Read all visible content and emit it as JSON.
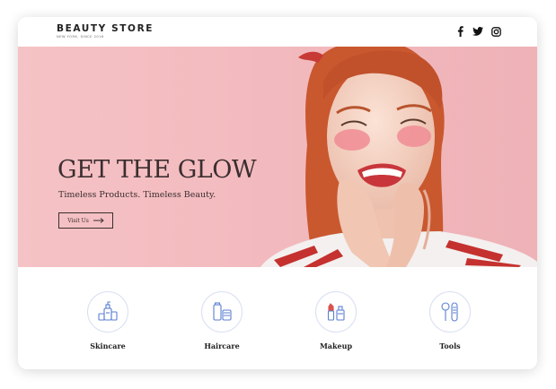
{
  "header": {
    "brand": "BEAUTY STORE",
    "tagline": "NEW YORK, SINCE 2016",
    "socials": [
      {
        "icon": "facebook-icon"
      },
      {
        "icon": "twitter-icon"
      },
      {
        "icon": "instagram-icon"
      }
    ]
  },
  "hero": {
    "title": "GET THE GLOW",
    "subtitle": "Timeless Products. Timeless Beauty.",
    "cta_label": "Visit Us",
    "cta_icon": "arrow-right-icon"
  },
  "categories": [
    {
      "label": "Skincare",
      "icon": "skincare-icon"
    },
    {
      "label": "Haircare",
      "icon": "haircare-icon"
    },
    {
      "label": "Makeup",
      "icon": "makeup-icon"
    },
    {
      "label": "Tools",
      "icon": "tools-icon"
    }
  ],
  "colors": {
    "hero_background": "#f2b9bd",
    "icon_accent": "#5b7fd1",
    "text_dark": "#3b2e30"
  }
}
